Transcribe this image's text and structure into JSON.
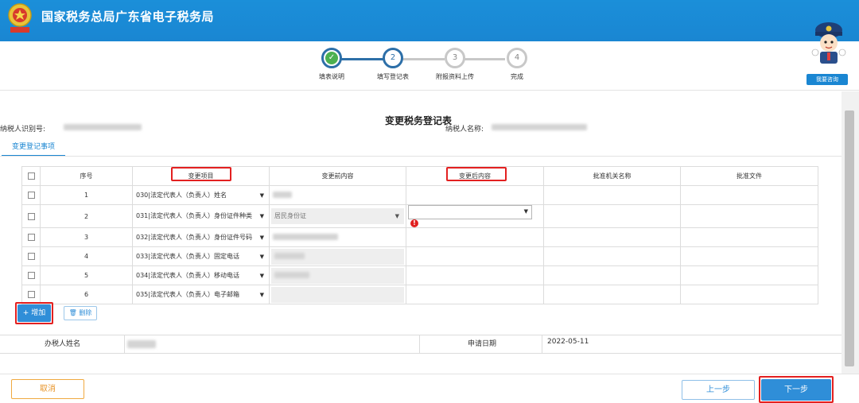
{
  "header": {
    "title": "国家税务总局广东省电子税务局"
  },
  "steps": [
    {
      "num": "",
      "label": "填表说明",
      "state": "done"
    },
    {
      "num": "2",
      "label": "填写登记表",
      "state": "active"
    },
    {
      "num": "3",
      "label": "附报资料上传",
      "state": "pending"
    },
    {
      "num": "4",
      "label": "完成",
      "state": "pending"
    }
  ],
  "assistant": {
    "consult_label": "我要咨询"
  },
  "form": {
    "title": "变更税务登记表",
    "taxpayer_id_label": "纳税人识别号:",
    "taxpayer_name_label": "纳税人名称:",
    "tab_label": "变更登记事项"
  },
  "table": {
    "headers": [
      "序号",
      "变更项目",
      "变更前内容",
      "变更后内容",
      "批准机关名称",
      "批准文件"
    ],
    "rows": [
      {
        "no": "1",
        "item": "030|法定代表人（负责人）姓名",
        "before": ""
      },
      {
        "no": "2",
        "item": "031|法定代表人（负责人）身份证件种类",
        "before": "居民身份证"
      },
      {
        "no": "3",
        "item": "032|法定代表人（负责人）身份证件号码",
        "before": ""
      },
      {
        "no": "4",
        "item": "033|法定代表人（负责人）固定电话",
        "before": ""
      },
      {
        "no": "5",
        "item": "034|法定代表人（负责人）移动电话",
        "before": ""
      },
      {
        "no": "6",
        "item": "035|法定代表人（负责人）电子邮箱",
        "before": ""
      }
    ]
  },
  "actions": {
    "add_label": "+ 增加",
    "delete_label": "删除"
  },
  "bottom": {
    "agent_label": "办税人姓名",
    "date_label": "申请日期",
    "date_value": "2022-05-11"
  },
  "footer": {
    "cancel_label": "取消",
    "prev_label": "上一步",
    "next_label": "下一步"
  },
  "colors": {
    "primary": "#1a86d2",
    "highlight": "#e32020",
    "cancel": "#f0a940",
    "done": "#4cb050"
  }
}
